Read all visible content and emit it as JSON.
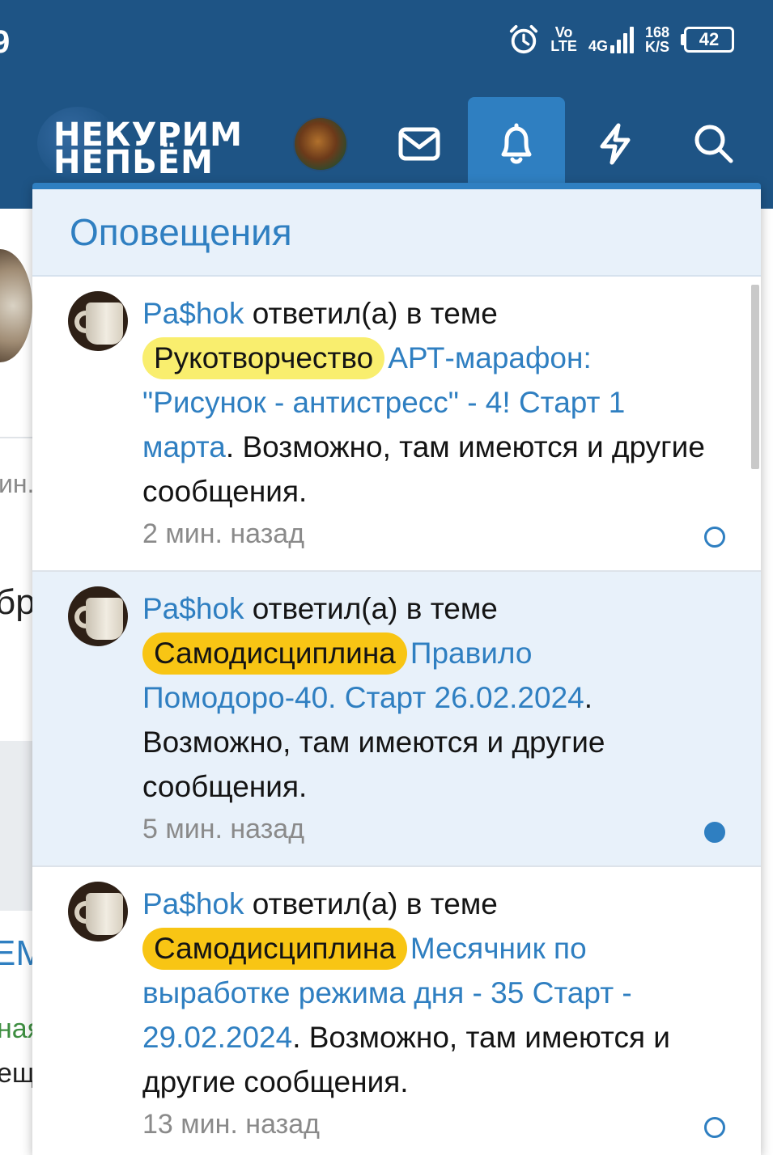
{
  "status_bar": {
    "time_fragment": "9",
    "volte_top": "Vo",
    "volte_bottom": "LTE",
    "network": "4G",
    "speed_value": "168",
    "speed_unit": "K/S",
    "battery": "42"
  },
  "nav": {
    "logo_line1": "НЕКУРИМ",
    "logo_line2": "НЕПЬЁМ",
    "active_item": "alerts",
    "icons": [
      "envelope-icon",
      "bell-icon",
      "bolt-icon",
      "search-icon"
    ]
  },
  "background_page": {
    "text1": "ин.",
    "text2": "бр",
    "text3": "ЕМ",
    "text4": "ная",
    "text5": "ещ"
  },
  "alerts_panel": {
    "title": "Оповещения",
    "items": [
      {
        "user": "Pa$hok",
        "action": " ответил(а) в теме ",
        "prefix": "Рукотворчество",
        "prefix_color": "#f9ee6e",
        "thread": "АРТ-марафон: \"Рисунок - антистресс\" - 4! Старт 1 марта",
        "suffix": ". Возможно, там имеются и другие сообщения.",
        "time": "2 мин. назад",
        "read": true
      },
      {
        "user": "Pa$hok",
        "action": " ответил(а) в теме ",
        "prefix": "Самодисциплина",
        "prefix_color": "#f8c514",
        "thread": "Правило Помодоро-40. Старт 26.02.2024",
        "suffix": ". Возможно, там имеются и другие сообщения.",
        "time": "5 мин. назад",
        "read": false
      },
      {
        "user": "Pa$hok",
        "action": " ответил(а) в теме ",
        "prefix": "Самодисциплина",
        "prefix_color": "#f8c514",
        "thread": "Месячник по выработке режима дня - 35 Старт - 29.02.2024",
        "suffix": ". Возможно, там имеются и другие сообщения.",
        "time": "13 мин. назад",
        "read": true
      }
    ]
  },
  "colors": {
    "header_bg": "#1e5485",
    "accent": "#2f7fc1",
    "unread_bg": "#e8f1fa"
  }
}
